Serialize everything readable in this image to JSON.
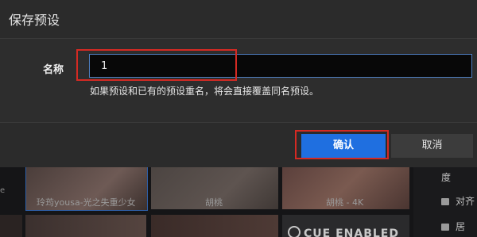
{
  "dialog": {
    "title": "保存预设",
    "field_label": "名称",
    "input_value": "1",
    "hint": "如果预设和已有的预设重名，将会直接覆盖同名预设。",
    "ok_label": "确认",
    "cancel_label": "取消"
  },
  "background": {
    "captions": [
      "玲荺yousa-光之失重少女",
      "胡桃",
      "胡桃 - 4K"
    ],
    "left_strip": "e",
    "brand_text": "CUE ENABLED",
    "side_items": [
      "度",
      "对齐",
      "居"
    ]
  },
  "colors": {
    "accent": "#1f6fe0",
    "highlight": "#d42a23",
    "input_border": "#4f7fc2"
  }
}
